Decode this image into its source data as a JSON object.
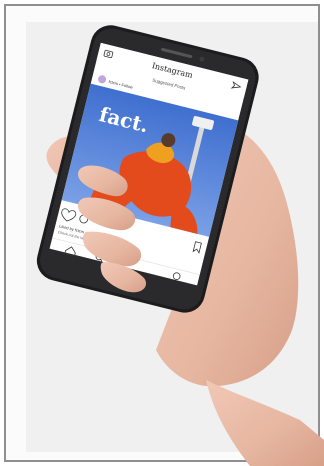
{
  "phone_screen": {
    "app_title": "Instagram",
    "suggested_label": "Suggested Posts",
    "account_row": "fctcrs • Follow",
    "post_brand": "fact.",
    "liked_by": "Liked by fctcrs and others",
    "caption": "Check out the latest issue..."
  },
  "colors": {
    "frame_border": "#8f8f8f",
    "post_sky": "#4f79c8",
    "outfit": "#e34a1c",
    "phone_body": "#1c1c1e",
    "skin": "#e6b6a0"
  },
  "icons": [
    "camera-icon",
    "send-icon",
    "heart-icon",
    "comment-icon",
    "bookmark-icon",
    "home-icon",
    "search-icon",
    "profile-icon"
  ]
}
